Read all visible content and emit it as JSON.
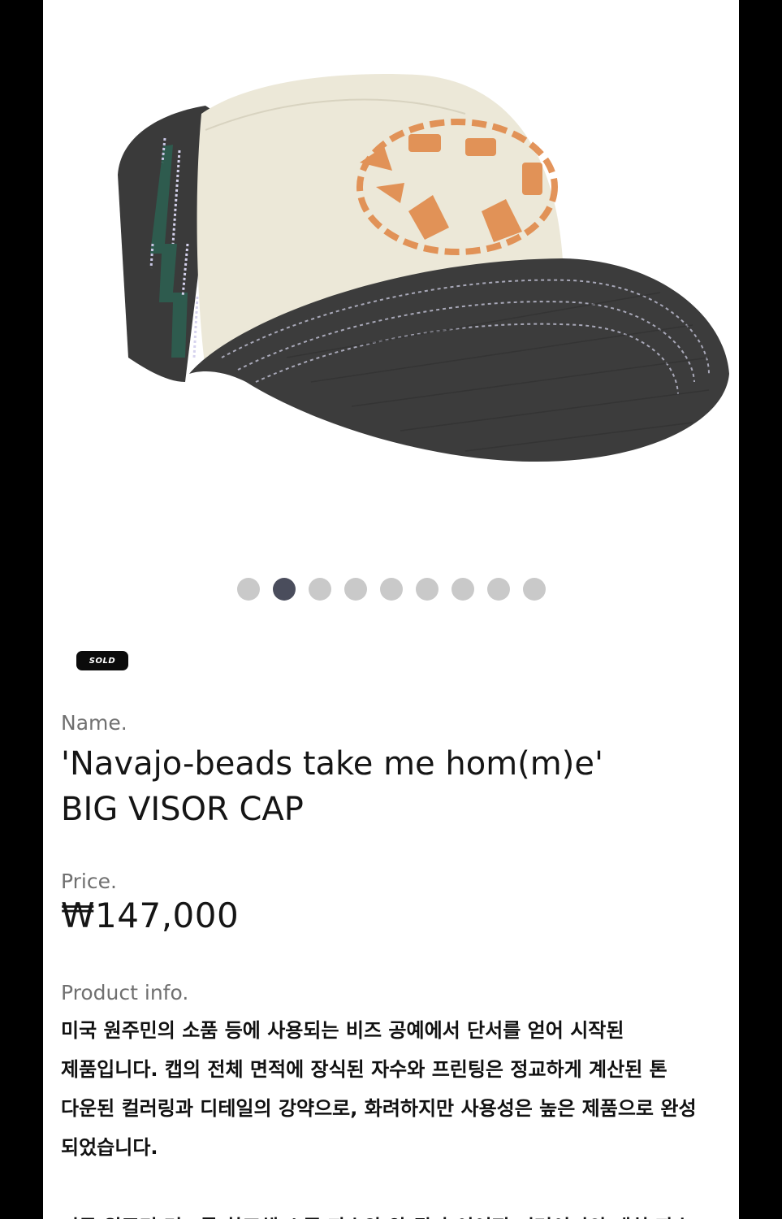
{
  "gallery": {
    "image_alt": "Navajo-beads BIG VISOR CAP photo",
    "dot_count": 9,
    "active_index": 1
  },
  "badge": {
    "label": "SOLD"
  },
  "product": {
    "name_label": "Name.",
    "name_line1": "'Navajo-beads take me hom(m)e'",
    "name_line2": "BIG VISOR CAP",
    "price_label": "Price.",
    "price": "₩147,000",
    "info_label": "Product info.",
    "info_text": "미국 원주민의 소품 등에 사용되는 비즈 공예에서 단서를 얻어 시작된 제품입니다. 캡의 전체 면적에 장식된 자수와 프린팅은 정교하게 계산된 톤 다운된 컬러링과 디테일의 강약으로, 화려하지만 사용성은 높은 제품으로 완성 되었습니다.",
    "info_text_next": "미국 원주민 러그를 참조해 소품 자수와 앞 뒤가 이어진 미러이미의 패치 자수"
  },
  "colors": {
    "page_bg": "#000000",
    "card_bg": "#ffffff",
    "dot_inactive": "#c9c9c9",
    "dot_active": "#4a4d5c",
    "label_gray": "#707070"
  }
}
